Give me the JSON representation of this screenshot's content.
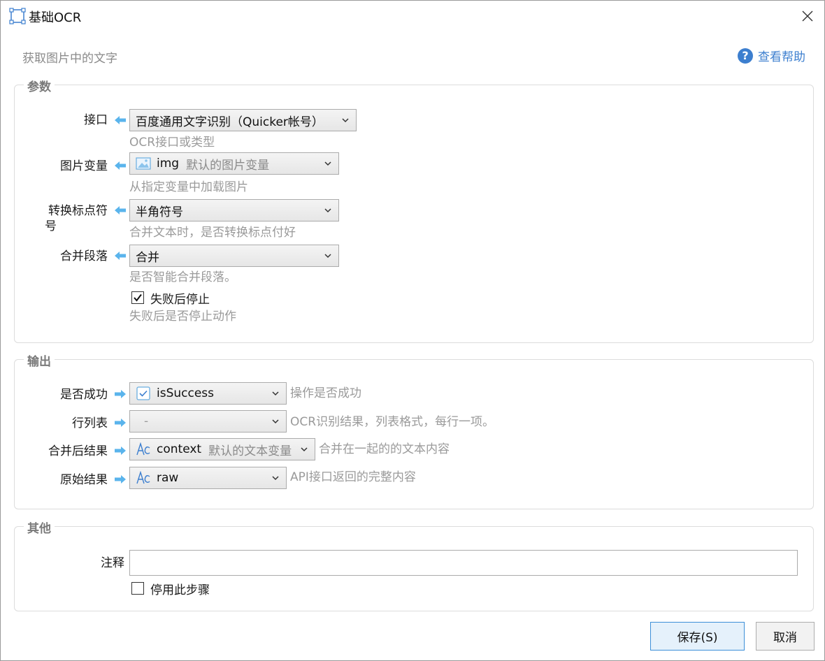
{
  "window": {
    "title": "基础OCR"
  },
  "header": {
    "subtitle": "获取图片中的文字",
    "help_label": "查看帮助"
  },
  "params": {
    "title": "参数",
    "api": {
      "label": "接口",
      "value": "百度通用文字识别（Quicker帐号）",
      "hint": "OCR接口或类型"
    },
    "image_var": {
      "label": "图片变量",
      "value": "img",
      "value_hint": "默认的图片变量",
      "hint": "从指定变量中加载图片"
    },
    "punct": {
      "label_line1": "转换标点符",
      "label_line2": "号",
      "value": "半角符号",
      "hint": "合并文本时，是否转换标点付好"
    },
    "merge": {
      "label": "合并段落",
      "value": "合并",
      "hint": "是否智能合并段落。"
    },
    "stop_on_fail": {
      "label": "失败后停止",
      "checked": true,
      "hint": "失败后是否停止动作"
    }
  },
  "output": {
    "title": "输出",
    "success": {
      "label": "是否成功",
      "value": "isSuccess",
      "hint": "操作是否成功"
    },
    "lines": {
      "label": "行列表",
      "value": "-",
      "hint": "OCR识别结果，列表格式，每行一项。"
    },
    "merged": {
      "label": "合并后结果",
      "value": "context",
      "value_hint": "默认的文本变量",
      "hint": "合并在一起的的文本内容"
    },
    "raw": {
      "label": "原始结果",
      "value": "raw",
      "hint": "API接口返回的完整内容"
    }
  },
  "other": {
    "title": "其他",
    "note": {
      "label": "注释",
      "value": ""
    },
    "disable": {
      "label": "停用此步骤",
      "checked": false
    }
  },
  "footer": {
    "save_label": "保存(S)",
    "cancel_label": "取消"
  },
  "colors": {
    "accent": "#3d7fcf",
    "arrow": "#5ab4ec",
    "hint": "#9a9a9a"
  }
}
